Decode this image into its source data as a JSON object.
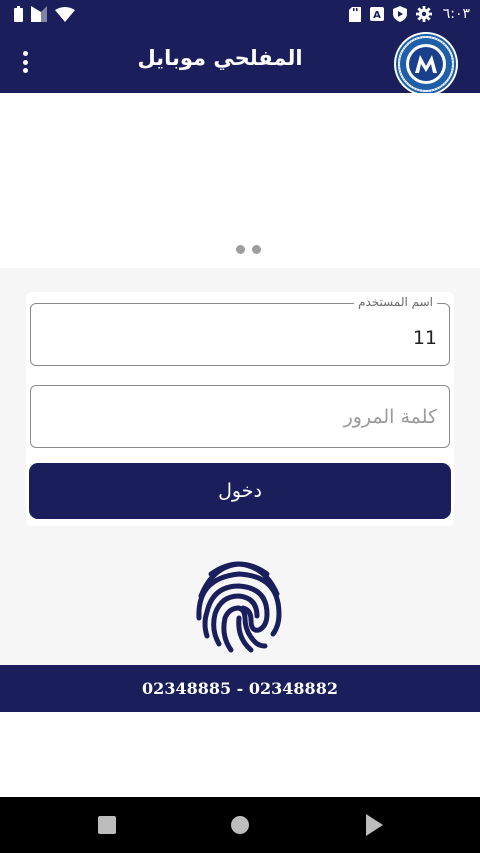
{
  "status_bar": {
    "time": "٦:٠٣",
    "left_icons": [
      "battery-icon",
      "signal-icon",
      "wifi-icon"
    ],
    "right_icons": [
      "sd-card-icon",
      "notification-a-icon",
      "shield-play-icon",
      "settings-gear-icon"
    ]
  },
  "app_bar": {
    "title": "المفلحي موبايل",
    "menu_icon": "more-vert-icon",
    "logo_icon": "company-logo-icon"
  },
  "slider": {
    "page_count": 2,
    "current_page": 0
  },
  "login_form": {
    "username": {
      "label": "اسم المستخدم",
      "value": "11"
    },
    "password": {
      "placeholder": "كلمة المرور",
      "value": ""
    },
    "submit_label": "دخول",
    "fingerprint_icon": "fingerprint-icon"
  },
  "footer": {
    "phones": "02348885 - 02348882"
  },
  "nav_bar": {
    "icons": [
      "square-stop-icon",
      "circle-home-icon",
      "triangle-back-icon"
    ]
  },
  "colors": {
    "primary": "#1a1f5c",
    "background": "#f6f6f6",
    "dot": "#9e9e9e"
  }
}
